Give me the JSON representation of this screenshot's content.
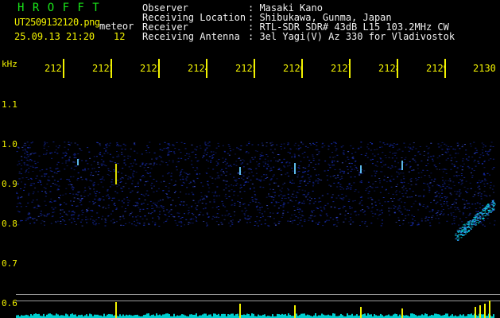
{
  "header": {
    "app_name": "H R O F F T",
    "filename": "UT2509132120.png",
    "type_label": "meteor",
    "date_time": "25.09.13 21:20",
    "count": "12"
  },
  "info": {
    "labels": [
      "Observer",
      "Receiving Location",
      "Receiver",
      "Receiving Antenna"
    ],
    "values": [
      ": Masaki Kano",
      ": Shibukawa, Gunma, Japan",
      ": RTL-SDR SDR# 43dB L15 103.2MHz CW",
      ": 3el Yagi(V) Az 330 for Vladivostok"
    ]
  },
  "time_axis": {
    "labels": [
      "2121",
      "2122",
      "2123",
      "2124",
      "2125",
      "2126",
      "2127",
      "2128",
      "2129",
      "2130"
    ]
  },
  "freq_axis": {
    "unit": "kHz",
    "labels": [
      "1.1",
      "1.0",
      "0.9",
      "0.8",
      "0.7",
      "0.6"
    ]
  },
  "colors": {
    "background": "#000000",
    "text_green": "#19e619",
    "text_yellow": "#f2f200",
    "text_white": "#f0f0f0",
    "noise_blue": "#1a33cc",
    "signal_cyan": "#00e5e5"
  }
}
